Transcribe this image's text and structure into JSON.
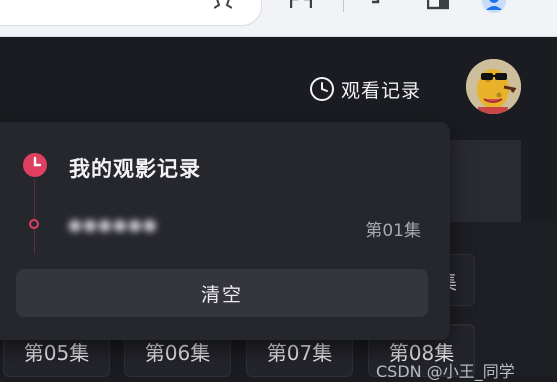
{
  "header": {
    "history_label": "观看记录"
  },
  "history_dropdown": {
    "title": "我的观影记录",
    "items": [
      {
        "name": "●●●●●●",
        "episode": "第01集"
      }
    ],
    "clear_label": "清空"
  },
  "episodes": {
    "row_partial_label": "集",
    "tiles": [
      "第05集",
      "第06集",
      "第07集",
      "第08集"
    ]
  },
  "watermark": "CSDN @小王_同学",
  "colors": {
    "accent": "#e0405f",
    "background": "#1b1c21",
    "dropdown": "#26272d",
    "button": "#34353d"
  }
}
